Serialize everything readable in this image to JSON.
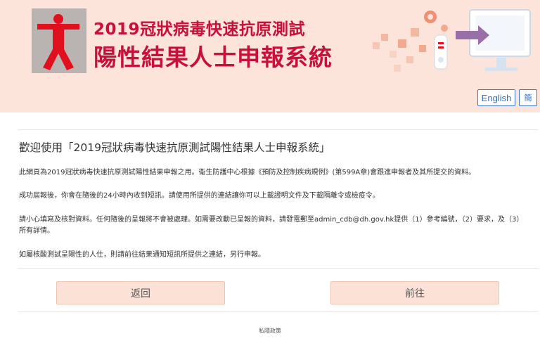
{
  "header": {
    "title_line1": "2019冠狀病毒快速抗原測試",
    "title_line2": "陽性結果人士申報系統",
    "lang_english": "English",
    "lang_simplified": "簡",
    "brand_color": "#c6113c",
    "background_color": "#fce4da"
  },
  "main": {
    "welcome": "歡迎使用「2019冠狀病毒快速抗原測試陽性結果人士申報系統」",
    "paragraphs": [
      "此網頁為2019冠狀病毒快速抗原測試陽性結果申報之用。衞生防護中心根據《預防及控制疾病規例》(第599A章)會跟進申報者及其所提交的資料。",
      "成功屆報後，你會在隨後的24小時內收到短訊。請使用所提供的連結讓你可以上載證明文件及下載隔離令或檢疫令。",
      "請小心填寫及核對資料。任何隨後的呈報將不會被處理。如需要改動已呈報的資料，請發電郵至admin_cdb@dh.gov.hk提供（1）參考編號，（2）要求，及（3）所有詳情。",
      "如屬核酸測試呈陽性的人仕，則請前往結果通知短訊所提供之連結，另行申報。"
    ]
  },
  "buttons": {
    "back": "返回",
    "next": "前往"
  },
  "footer": {
    "privacy": "私隱政策"
  }
}
